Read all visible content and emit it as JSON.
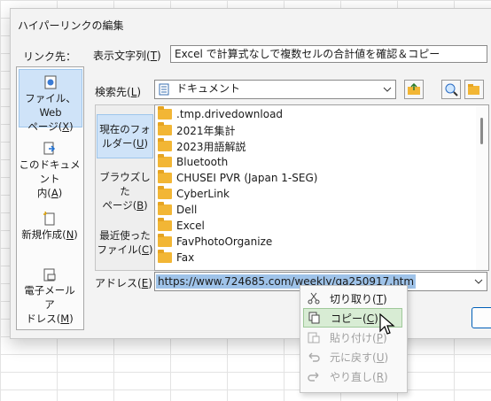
{
  "dialog": {
    "title": "ハイパーリンクの編集",
    "link_to_label": "リンク先：",
    "display_text_label": "表示文字列(",
    "display_text_key": "T",
    "display_text_value": "Excel で計算式なしで複数セルの合計値を確認＆コピー",
    "look_in_label": "検索先(",
    "look_in_key": "L",
    "look_in_value": "ドキュメント",
    "address_label": "アドレス(",
    "address_key": "E",
    "address_value": "https://www.724685.com/weekly/qa250917.htm"
  },
  "link_types": [
    {
      "line1": "ファイル、Web",
      "line2": "ページ(",
      "key": "X",
      "icon": "web-page-icon"
    },
    {
      "line1": "このドキュメント",
      "line2": "内(",
      "key": "A",
      "icon": "place-in-document-icon"
    },
    {
      "line1": "新規作成(",
      "line2": "",
      "key": "N",
      "icon": "new-document-icon"
    },
    {
      "line1": "電子メール ア",
      "line2": "ドレス(",
      "key": "M",
      "icon": "email-address-icon"
    }
  ],
  "lookin_options": [
    {
      "line1": "現在のフォ",
      "line2": "ルダー(",
      "key": "U"
    },
    {
      "line1": "ブラウズした",
      "line2": "ページ(",
      "key": "B"
    },
    {
      "line1": "最近使った",
      "line2": "ファイル(",
      "key": "C"
    }
  ],
  "files": [
    ".tmp.drivedownload",
    "2021年集計",
    "2023用語解説",
    "Bluetooth",
    "CHUSEI PVR (Japan 1-SEG)",
    "CyberLink",
    "Dell",
    "Excel",
    "FavPhotoOrganize",
    "Fax"
  ],
  "context_menu": [
    {
      "label": "切り取り(",
      "key": "T",
      "icon": "scissors-icon",
      "state": "normal"
    },
    {
      "label": "コピー(",
      "key": "C",
      "icon": "copy-icon",
      "state": "highlighted"
    },
    {
      "label": "貼り付け(",
      "key": "P",
      "icon": "paste-icon",
      "state": "disabled"
    },
    {
      "label": "元に戻す(",
      "key": "U",
      "icon": "undo-icon",
      "state": "disabled"
    },
    {
      "label": "やり直し(",
      "key": "R",
      "icon": "redo-icon",
      "state": "disabled"
    }
  ],
  "paren_close": ")"
}
